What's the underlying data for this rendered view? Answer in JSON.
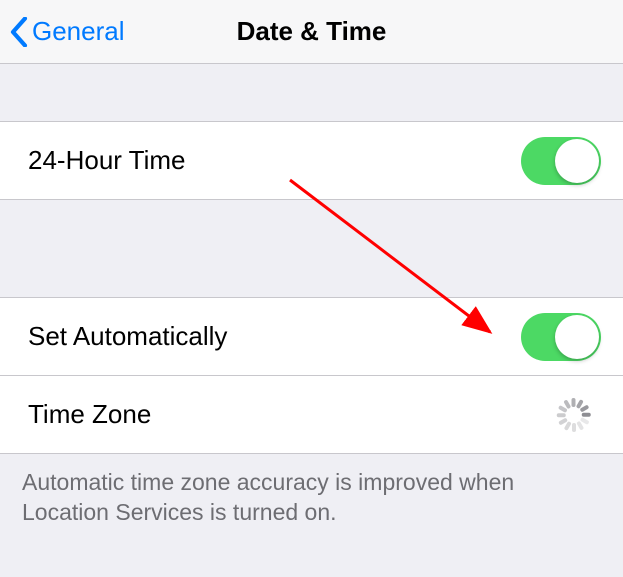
{
  "header": {
    "back_label": "General",
    "title": "Date & Time"
  },
  "rows": {
    "twenty_four_hour": {
      "label": "24-Hour Time",
      "toggle_on": true
    },
    "set_auto": {
      "label": "Set Automatically",
      "toggle_on": true
    },
    "time_zone": {
      "label": "Time Zone"
    }
  },
  "footer": {
    "text": "Automatic time zone accuracy is improved when Location Services is turned on."
  }
}
